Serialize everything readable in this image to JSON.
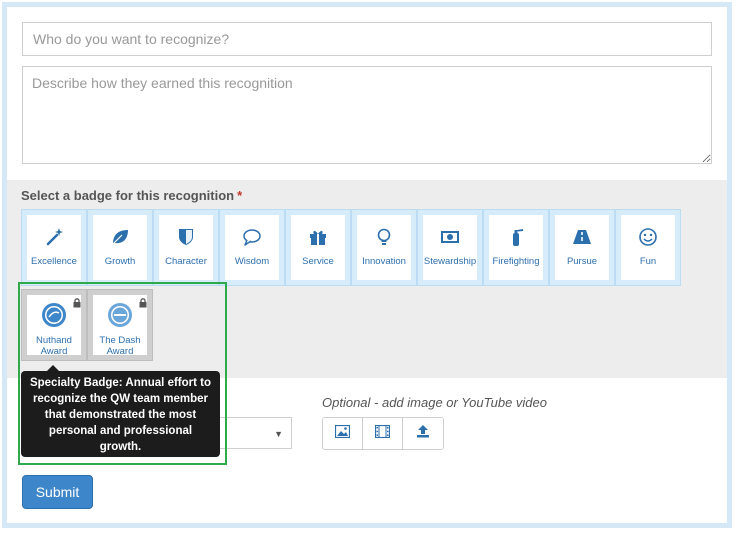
{
  "form": {
    "recipient_placeholder": "Who do you want to recognize?",
    "description_placeholder": "Describe how they earned this recognition",
    "badge_label": "Select a badge for this recognition",
    "required_marker": "*",
    "media_label": "Optional - add image or YouTube video",
    "submit_label": "Submit"
  },
  "badges": [
    {
      "label": "Excellence",
      "icon": "magic-wand-icon"
    },
    {
      "label": "Growth",
      "icon": "leaf-icon"
    },
    {
      "label": "Character",
      "icon": "shield-icon"
    },
    {
      "label": "Wisdom",
      "icon": "speech-bubble-icon"
    },
    {
      "label": "Service",
      "icon": "gift-icon"
    },
    {
      "label": "Innovation",
      "icon": "lightbulb-icon"
    },
    {
      "label": "Stewardship",
      "icon": "money-icon"
    },
    {
      "label": "Firefighting",
      "icon": "fire-extinguisher-icon"
    },
    {
      "label": "Pursue",
      "icon": "road-icon"
    },
    {
      "label": "Fun",
      "icon": "smiley-icon"
    }
  ],
  "special_badges": [
    {
      "label_line1": "Nuthand",
      "label_line2": "Award",
      "icon": "award-seal-icon",
      "locked": true
    },
    {
      "label_line1": "The Dash",
      "label_line2": "Award",
      "icon": "award-seal-icon",
      "locked": true
    }
  ],
  "tooltip": {
    "text": "Specialty Badge: Annual effort to recognize the QW team member that demonstrated the most personal and professional growth."
  },
  "colors": {
    "accent": "#3d86c9",
    "badge_text": "#2c6fad",
    "highlight": "#2eaa4a"
  }
}
